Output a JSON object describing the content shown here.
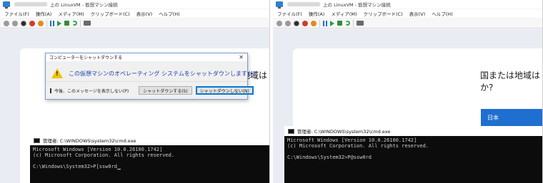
{
  "left": {
    "title": "上の LinuxVM - 仮想マシン接続",
    "menu": [
      "ファイル(F)",
      "操作(A)",
      "メディア(M)",
      "クリップボード(C)",
      "表示(V)",
      "ヘルプ(H)"
    ],
    "oobe_heading_line1": "国または地域は",
    "dialog": {
      "title": "コンピューターをシャットダウンする",
      "close": "✕",
      "message": "この仮想マシンのオペレーティング システムをシャットダウンしますか?",
      "checkbox_label": "今後、このメッセージを表示しない(P)",
      "button_yes": "シャットダウンする(S)",
      "button_no": "シャットダウンしない(N)"
    },
    "cmd": {
      "title": "管理者: C:\\WINDOWS\\system32\\cmd.exe",
      "line1": "Microsoft Windows [Version 10.0.26100.1742]",
      "line2": "(c) Microsoft Corporation. All rights reserved.",
      "line3": "",
      "prompt": "C:\\Windows\\System32>P[ssw0rd"
    }
  },
  "right": {
    "title": "上の LinuxVM - 仮想マシン接続",
    "menu": [
      "ファイル(F)",
      "操作(A)",
      "メディア(M)",
      "クリップボード(C)",
      "表示(V)",
      "ヘルプ(H)"
    ],
    "oobe_heading_line1": "国または地域は",
    "oobe_heading_line2": "か?",
    "region_selected": "日本",
    "cmd": {
      "title": "管理者: C:\\WINDOWS\\system32\\cmd.exe",
      "line1": "Microsoft Windows [Version 10.0.26100.1742]",
      "line2": "(c) Microsoft Corporation. All rights reserved.",
      "line3": "",
      "prompt": "C:\\Windows\\System32>P@ssw0rd"
    }
  }
}
